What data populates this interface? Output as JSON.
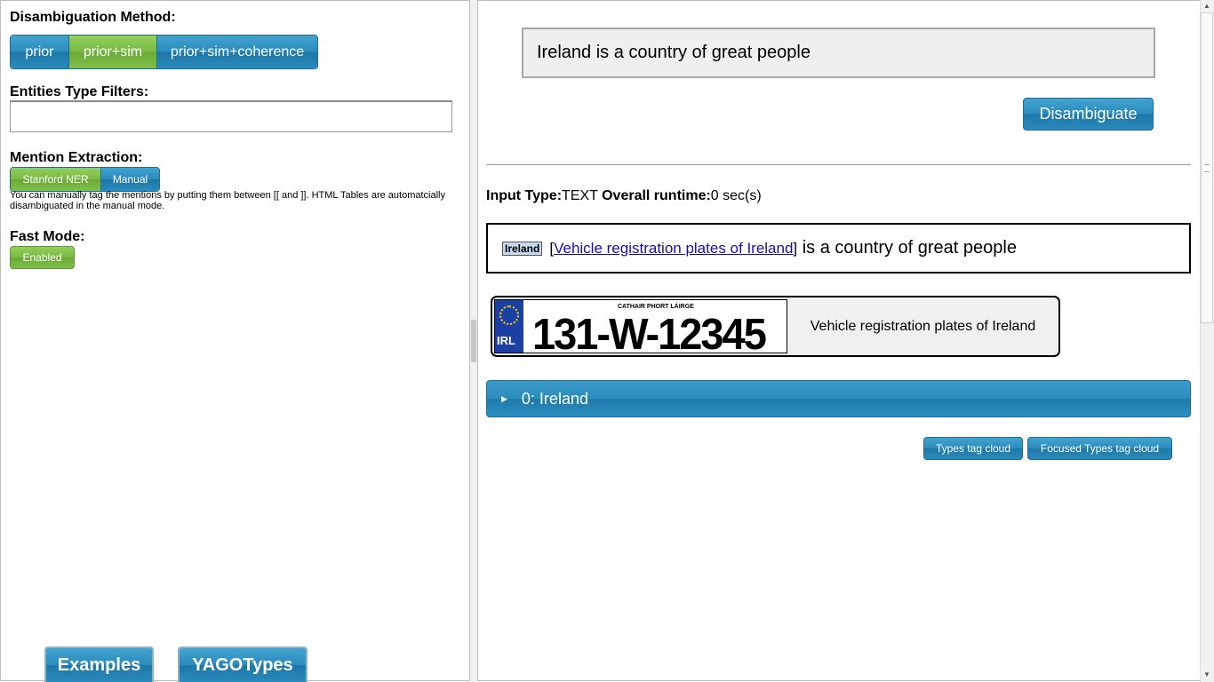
{
  "left": {
    "disambiguation_label": "Disambiguation Method:",
    "methods": [
      "prior",
      "prior+sim",
      "prior+sim+coherence"
    ],
    "selected_method": "prior+sim",
    "type_filter_label": "Entities Type Filters:",
    "type_filter_value": "",
    "mention_label": "Mention Extraction:",
    "mention_options": [
      "Stanford NER",
      "Manual"
    ],
    "selected_mention": "Stanford NER",
    "manual_note": "You can manually tag the mentions by putting them between [[ and ]]. HTML Tables are automatcially disambiguated in the manual mode.",
    "fast_mode_label": "Fast Mode:",
    "fast_mode_value": "Enabled",
    "examples_button": "Examples",
    "yago_button": "YAGOTypes"
  },
  "right": {
    "input_text": "Ireland is a country of great people",
    "disambiguate_button": "Disambiguate",
    "input_type_label": "Input Type:",
    "input_type_value": "TEXT",
    "runtime_label": "Overall runtime:",
    "runtime_value": "0 sec(s)",
    "result": {
      "mention": "Ireland",
      "open_bracket": "[",
      "entity": "Vehicle registration plates of Ireland",
      "close_bracket": "]",
      "rest": " is a country of great people"
    },
    "card": {
      "plate_country": "IRL",
      "plate_county": "CATHAIR PHORT LÁIRGE",
      "plate_number": "131-W-12345",
      "title": "Vehicle registration plates of Ireland"
    },
    "accordion_label": "0: Ireland",
    "types_cloud_button": "Types tag cloud",
    "focused_types_button": "Focused Types tag cloud"
  },
  "colors": {
    "accent_blue": "#2a8bbd",
    "accent_green": "#79b944",
    "link": "#1a0dab"
  }
}
